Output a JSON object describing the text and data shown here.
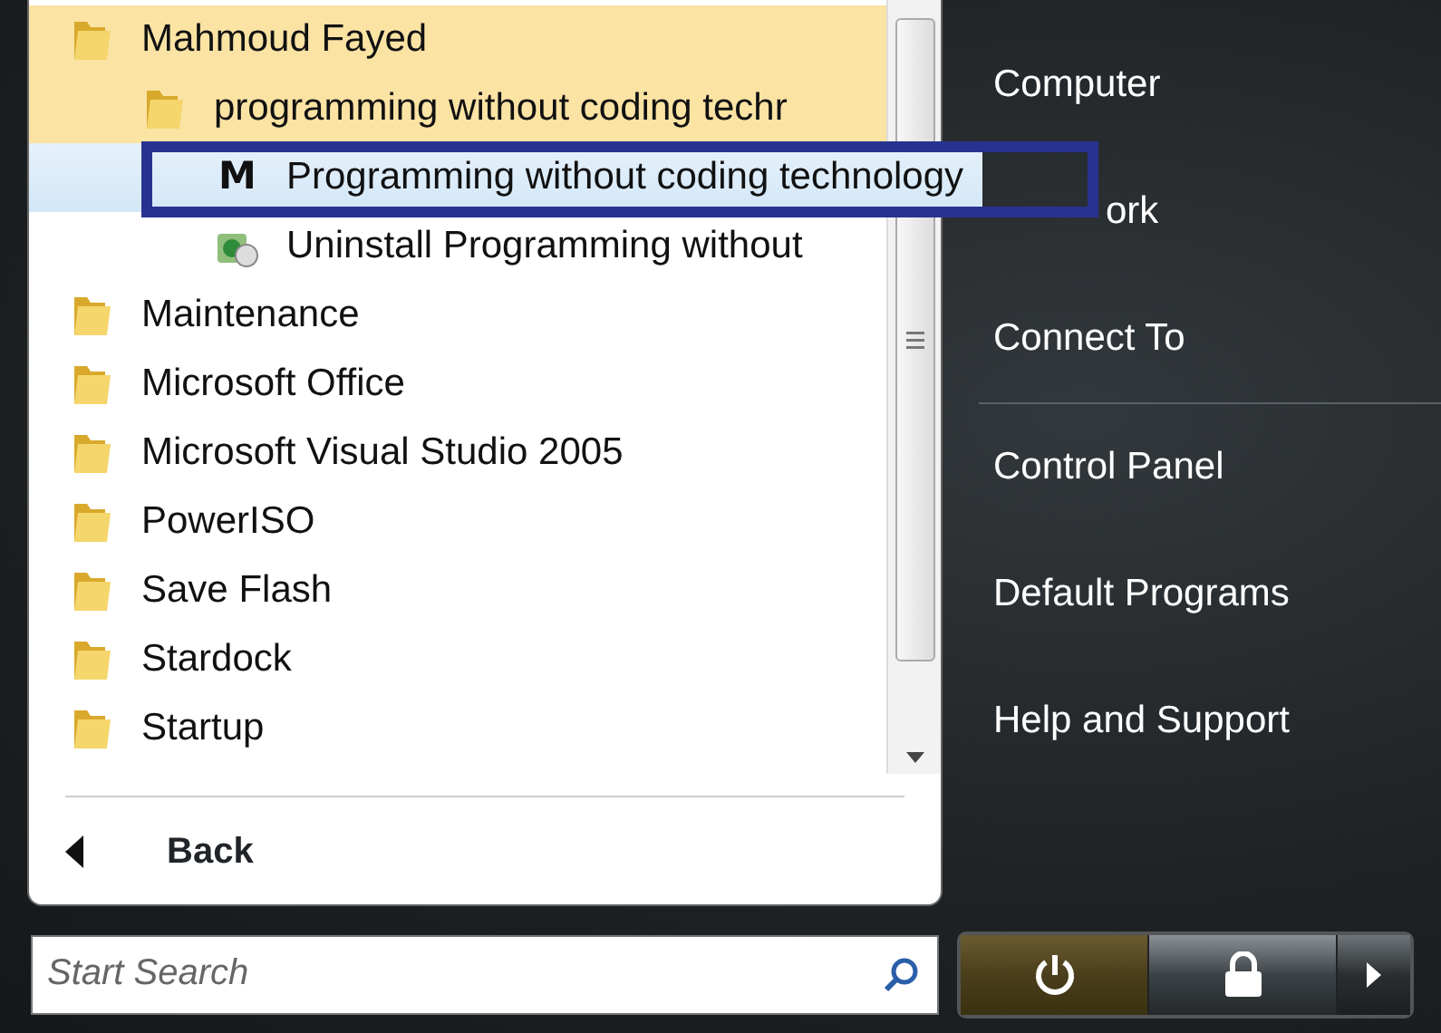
{
  "programs": [
    {
      "kind": "folder",
      "label": "Mahmoud Fayed",
      "expanded": true,
      "selected": false,
      "outlined": false,
      "children": [
        {
          "kind": "folder",
          "label": "programming without coding techr",
          "expanded": true,
          "selected": false,
          "outlined": false,
          "children": [
            {
              "kind": "app",
              "icon_text": "M",
              "label": "Programming without coding technology",
              "expanded": false,
              "selected": true,
              "outlined": true
            },
            {
              "kind": "uninstall",
              "label": "Uninstall Programming without",
              "expanded": false,
              "selected": false,
              "outlined": false
            }
          ]
        }
      ]
    },
    {
      "kind": "folder",
      "label": "Maintenance",
      "expanded": false,
      "selected": false,
      "outlined": false
    },
    {
      "kind": "folder",
      "label": "Microsoft Office",
      "expanded": false,
      "selected": false,
      "outlined": false
    },
    {
      "kind": "folder",
      "label": "Microsoft Visual Studio 2005",
      "expanded": false,
      "selected": false,
      "outlined": false
    },
    {
      "kind": "folder",
      "label": "PowerISO",
      "expanded": false,
      "selected": false,
      "outlined": false
    },
    {
      "kind": "folder",
      "label": "Save Flash",
      "expanded": false,
      "selected": false,
      "outlined": false
    },
    {
      "kind": "folder",
      "label": "Stardock",
      "expanded": false,
      "selected": false,
      "outlined": false
    },
    {
      "kind": "folder",
      "label": "Startup",
      "expanded": false,
      "selected": false,
      "outlined": false
    }
  ],
  "back": {
    "label": "Back"
  },
  "search": {
    "placeholder": "Start Search"
  },
  "places": [
    [
      "Computer",
      "ork",
      "Connect To"
    ],
    [
      "Control Panel",
      "Default Programs",
      "Help and Support"
    ]
  ]
}
